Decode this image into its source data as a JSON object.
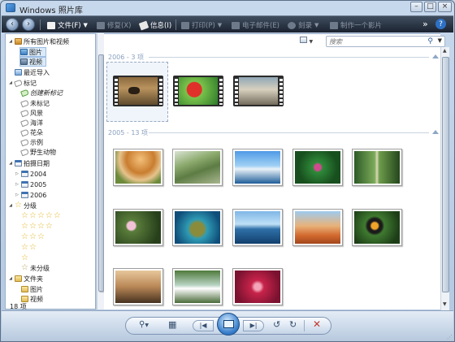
{
  "window": {
    "title": "Windows 照片库",
    "controls": [
      "–",
      "□",
      "×"
    ]
  },
  "toolbar": {
    "file": "文件(F)",
    "fix": "修复(X)",
    "info": "信息(I)",
    "print": "打印(P)",
    "email": "电子邮件(E)",
    "burn": "刻录",
    "movie": "制作一个影片",
    "more": "»",
    "help": "?"
  },
  "tree": {
    "all": "所有图片和视频",
    "pictures": "图片",
    "videos": "视频",
    "recent": "最近导入",
    "tags": "标记",
    "create_tag": "创建新标记",
    "untagged": "未标记",
    "tag_landscape": "风景",
    "tag_ocean": "海洋",
    "tag_flowers": "花朵",
    "tag_sample": "示例",
    "tag_wildlife": "野生动物",
    "date_taken": "拍摄日期",
    "year_2004": "2004",
    "year_2005": "2005",
    "year_2006": "2006",
    "ratings": "分级",
    "unrated": "未分级",
    "folders": "文件夹",
    "folder_pictures": "图片",
    "folder_videos": "视频"
  },
  "status": "18 项",
  "search": {
    "placeholder": "搜索"
  },
  "groups": {
    "g2006": "2006 - 3 项",
    "g2005": "2005 - 13 项"
  },
  "colors": {
    "toolbar_bg": "#1b2330",
    "accent": "#3a7fcc",
    "group_text": "#8aa0bf"
  },
  "icons": {
    "back": "back-arrow-icon",
    "forward": "forward-arrow-icon",
    "search": "magnifier-icon",
    "rotate_ccw": "rotate-ccw-icon",
    "rotate_cw": "rotate-cw-icon",
    "delete": "delete-x-icon"
  }
}
